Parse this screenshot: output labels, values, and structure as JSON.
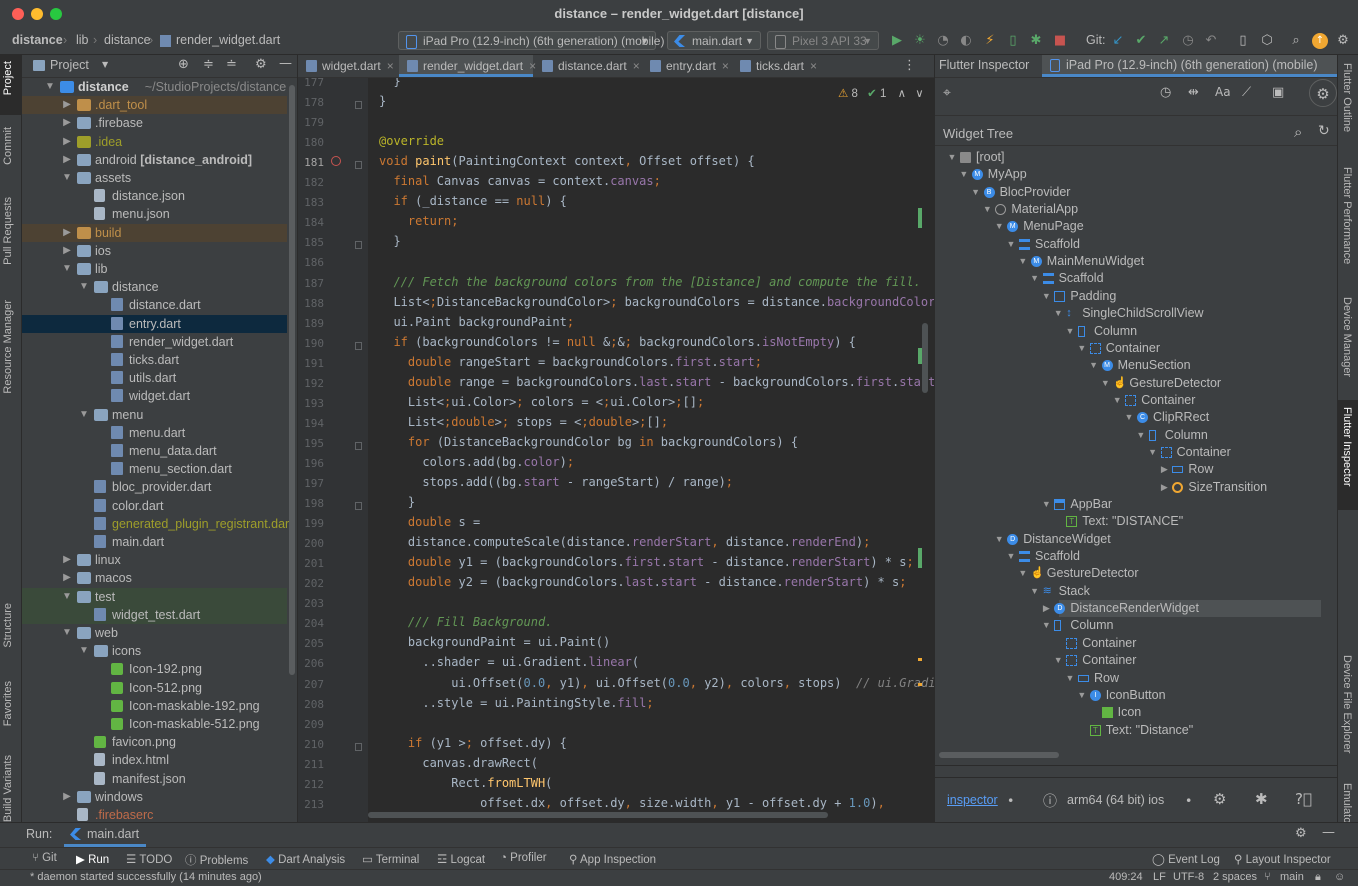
{
  "window": {
    "title": "distance – render_widget.dart [distance]"
  },
  "breadcrumbs": [
    "distance",
    "lib",
    "distance",
    "render_widget.dart"
  ],
  "toolbar": {
    "device_selector": "iPad Pro (12.9-inch) (6th generation) (mobile)",
    "run_config": "main.dart",
    "emulator": "Pixel 3 API 33",
    "git_label": "Git:"
  },
  "left_strip": [
    "Project",
    "Commit",
    "Pull Requests",
    "Resource Manager",
    "Structure",
    "Favorites",
    "Build Variants"
  ],
  "right_strip": [
    "Flutter Outline",
    "Flutter Performance",
    "Device Manager",
    "Flutter Inspector",
    "Device File Explorer",
    "Emulator"
  ],
  "project": {
    "title": "Project",
    "tree": [
      {
        "label": "distance",
        "suffix": "~/StudioProjects/distance",
        "type": "root"
      },
      {
        "label": ".dart_tool",
        "type": "folder",
        "color": "#bf8f4a"
      },
      {
        "label": ".firebase",
        "type": "folder"
      },
      {
        "label": ".idea",
        "type": "folder",
        "color": "#9e9e2a"
      },
      {
        "label": "android [distance_android]",
        "type": "folder"
      },
      {
        "label": "assets",
        "type": "folder"
      },
      {
        "label": "distance.json",
        "type": "json"
      },
      {
        "label": "menu.json",
        "type": "json"
      },
      {
        "label": "build",
        "type": "folder",
        "color": "#bf8f4a"
      },
      {
        "label": "ios",
        "type": "folder"
      },
      {
        "label": "lib",
        "type": "folder"
      },
      {
        "label": "distance",
        "type": "folder"
      },
      {
        "label": "distance.dart",
        "type": "dart"
      },
      {
        "label": "entry.dart",
        "type": "dart"
      },
      {
        "label": "render_widget.dart",
        "type": "dart"
      },
      {
        "label": "ticks.dart",
        "type": "dart"
      },
      {
        "label": "utils.dart",
        "type": "dart"
      },
      {
        "label": "widget.dart",
        "type": "dart"
      },
      {
        "label": "menu",
        "type": "folder"
      },
      {
        "label": "menu.dart",
        "type": "dart"
      },
      {
        "label": "menu_data.dart",
        "type": "dart"
      },
      {
        "label": "menu_section.dart",
        "type": "dart"
      },
      {
        "label": "bloc_provider.dart",
        "type": "dart"
      },
      {
        "label": "color.dart",
        "type": "dart"
      },
      {
        "label": "generated_plugin_registrant.dart",
        "type": "dart",
        "color": "#9e9e2a"
      },
      {
        "label": "main.dart",
        "type": "dart"
      },
      {
        "label": "linux",
        "type": "folder"
      },
      {
        "label": "macos",
        "type": "folder"
      },
      {
        "label": "test",
        "type": "folder"
      },
      {
        "label": "widget_test.dart",
        "type": "dart"
      },
      {
        "label": "web",
        "type": "folder"
      },
      {
        "label": "icons",
        "type": "folder"
      },
      {
        "label": "Icon-192.png",
        "type": "png"
      },
      {
        "label": "Icon-512.png",
        "type": "png"
      },
      {
        "label": "Icon-maskable-192.png",
        "type": "png"
      },
      {
        "label": "Icon-maskable-512.png",
        "type": "png"
      },
      {
        "label": "favicon.png",
        "type": "png"
      },
      {
        "label": "index.html",
        "type": "html"
      },
      {
        "label": "manifest.json",
        "type": "json"
      },
      {
        "label": "windows",
        "type": "folder"
      },
      {
        "label": ".firebaserc",
        "type": "file",
        "color": "#bf6b4a"
      }
    ]
  },
  "editor": {
    "tabs": [
      "widget.dart",
      "render_widget.dart",
      "distance.dart",
      "entry.dart",
      "ticks.dart"
    ],
    "active_tab": "render_widget.dart",
    "warnings": "8",
    "weak_warnings": "1",
    "lines": [
      {
        "n": "177",
        "code": "  }"
      },
      {
        "n": "178",
        "code": "}"
      },
      {
        "n": "179",
        "code": ""
      },
      {
        "n": "180",
        "code": "@override"
      },
      {
        "n": "181",
        "code": "void paint(PaintingContext context, Offset offset) {"
      },
      {
        "n": "182",
        "code": "  final Canvas canvas = context.canvas;"
      },
      {
        "n": "183",
        "code": "  if (_distance == null) {"
      },
      {
        "n": "184",
        "code": "    return;"
      },
      {
        "n": "185",
        "code": "  }"
      },
      {
        "n": "186",
        "code": ""
      },
      {
        "n": "187",
        "code": "  /// Fetch the background colors from the [Distance] and compute the fill."
      },
      {
        "n": "188",
        "code": "  List<DistanceBackgroundColor> backgroundColors = distance.backgroundColors;"
      },
      {
        "n": "189",
        "code": "  ui.Paint backgroundPaint;"
      },
      {
        "n": "190",
        "code": "  if (backgroundColors != null && backgroundColors.isNotEmpty) {"
      },
      {
        "n": "191",
        "code": "    double rangeStart = backgroundColors.first.start;"
      },
      {
        "n": "192",
        "code": "    double range = backgroundColors.last.start - backgroundColors.first.start;"
      },
      {
        "n": "193",
        "code": "    List<ui.Color> colors = <ui.Color>[];"
      },
      {
        "n": "194",
        "code": "    List<double> stops = <double>[];"
      },
      {
        "n": "195",
        "code": "    for (DistanceBackgroundColor bg in backgroundColors) {"
      },
      {
        "n": "196",
        "code": "      colors.add(bg.color);"
      },
      {
        "n": "197",
        "code": "      stops.add((bg.start - rangeStart) / range);"
      },
      {
        "n": "198",
        "code": "    }"
      },
      {
        "n": "199",
        "code": "    double s ="
      },
      {
        "n": "200",
        "code": "    distance.computeScale(distance.renderStart, distance.renderEnd);"
      },
      {
        "n": "201",
        "code": "    double y1 = (backgroundColors.first.start - distance.renderStart) * s;"
      },
      {
        "n": "202",
        "code": "    double y2 = (backgroundColors.last.start - distance.renderStart) * s;"
      },
      {
        "n": "203",
        "code": ""
      },
      {
        "n": "204",
        "code": "    /// Fill Background."
      },
      {
        "n": "205",
        "code": "    backgroundPaint = ui.Paint()"
      },
      {
        "n": "206",
        "code": "      ..shader = ui.Gradient.linear("
      },
      {
        "n": "207",
        "code": "          ui.Offset(0.0, y1), ui.Offset(0.0, y2), colors, stops)  // ui.Gradie"
      },
      {
        "n": "208",
        "code": "      ..style = ui.PaintingStyle.fill;"
      },
      {
        "n": "209",
        "code": ""
      },
      {
        "n": "210",
        "code": "    if (y1 > offset.dy) {"
      },
      {
        "n": "211",
        "code": "      canvas.drawRect("
      },
      {
        "n": "212",
        "code": "          Rect.fromLTWH("
      },
      {
        "n": "213",
        "code": "              offset.dx, offset.dy, size.width, y1 - offset.dy + 1.0),"
      }
    ]
  },
  "inspector": {
    "tab1": "Flutter Inspector",
    "tab2": "iPad Pro (12.9-inch) (6th generation) (mobile)",
    "widget_tree_title": "Widget Tree",
    "tree": [
      {
        "label": "[root]",
        "depth": 0,
        "icon": "folder"
      },
      {
        "label": "MyApp",
        "depth": 1,
        "icon": "M"
      },
      {
        "label": "BlocProvider",
        "depth": 2,
        "icon": "B"
      },
      {
        "label": "MaterialApp",
        "depth": 3,
        "icon": "material"
      },
      {
        "label": "MenuPage",
        "depth": 4,
        "icon": "M"
      },
      {
        "label": "Scaffold",
        "depth": 5,
        "icon": "scaffold"
      },
      {
        "label": "MainMenuWidget",
        "depth": 6,
        "icon": "M"
      },
      {
        "label": "Scaffold",
        "depth": 7,
        "icon": "scaffold"
      },
      {
        "label": "Padding",
        "depth": 8,
        "icon": "padding"
      },
      {
        "label": "SingleChildScrollView",
        "depth": 9,
        "icon": "scroll"
      },
      {
        "label": "Column",
        "depth": 10,
        "icon": "column"
      },
      {
        "label": "Container",
        "depth": 11,
        "icon": "container"
      },
      {
        "label": "MenuSection",
        "depth": 12,
        "icon": "M"
      },
      {
        "label": "GestureDetector",
        "depth": 13,
        "icon": "gesture"
      },
      {
        "label": "Container",
        "depth": 14,
        "icon": "container"
      },
      {
        "label": "ClipRRect",
        "depth": 15,
        "icon": "C"
      },
      {
        "label": "Column",
        "depth": 16,
        "icon": "column"
      },
      {
        "label": "Container",
        "depth": 17,
        "icon": "container"
      },
      {
        "label": "Row",
        "depth": 18,
        "icon": "row"
      },
      {
        "label": "SizeTransition",
        "depth": 18,
        "icon": "transition"
      },
      {
        "label": "AppBar",
        "depth": 8,
        "icon": "appbar"
      },
      {
        "label": "Text: \"DISTANCE\"",
        "depth": 9,
        "icon": "text"
      },
      {
        "label": "DistanceWidget",
        "depth": 4,
        "icon": "D"
      },
      {
        "label": "Scaffold",
        "depth": 5,
        "icon": "scaffold"
      },
      {
        "label": "GestureDetector",
        "depth": 6,
        "icon": "gesture"
      },
      {
        "label": "Stack",
        "depth": 7,
        "icon": "stack"
      },
      {
        "label": "DistanceRenderWidget",
        "depth": 8,
        "icon": "D",
        "selected": true
      },
      {
        "label": "Column",
        "depth": 8,
        "icon": "column"
      },
      {
        "label": "Container",
        "depth": 9,
        "icon": "container"
      },
      {
        "label": "Container",
        "depth": 9,
        "icon": "container"
      },
      {
        "label": "Row",
        "depth": 10,
        "icon": "row"
      },
      {
        "label": "IconButton",
        "depth": 11,
        "icon": "I"
      },
      {
        "label": "Icon",
        "depth": 12,
        "icon": "image"
      },
      {
        "label": "Text: \"Distance\"",
        "depth": 11,
        "icon": "text"
      }
    ],
    "footer": {
      "link": "inspector",
      "arch": "arm64 (64 bit) ios"
    }
  },
  "run": {
    "label": "Run:",
    "config": "main.dart"
  },
  "bottom_tools": [
    "Git",
    "Run",
    "TODO",
    "Problems",
    "Dart Analysis",
    "Terminal",
    "Logcat",
    "Profiler",
    "App Inspection"
  ],
  "bottom_right_tools": [
    "Event Log",
    "Layout Inspector"
  ],
  "status": {
    "message": "* daemon started successfully (14 minutes ago)",
    "position": "409:24",
    "line_sep": "LF",
    "encoding": "UTF-8",
    "indent": "2 spaces",
    "branch": "main"
  }
}
